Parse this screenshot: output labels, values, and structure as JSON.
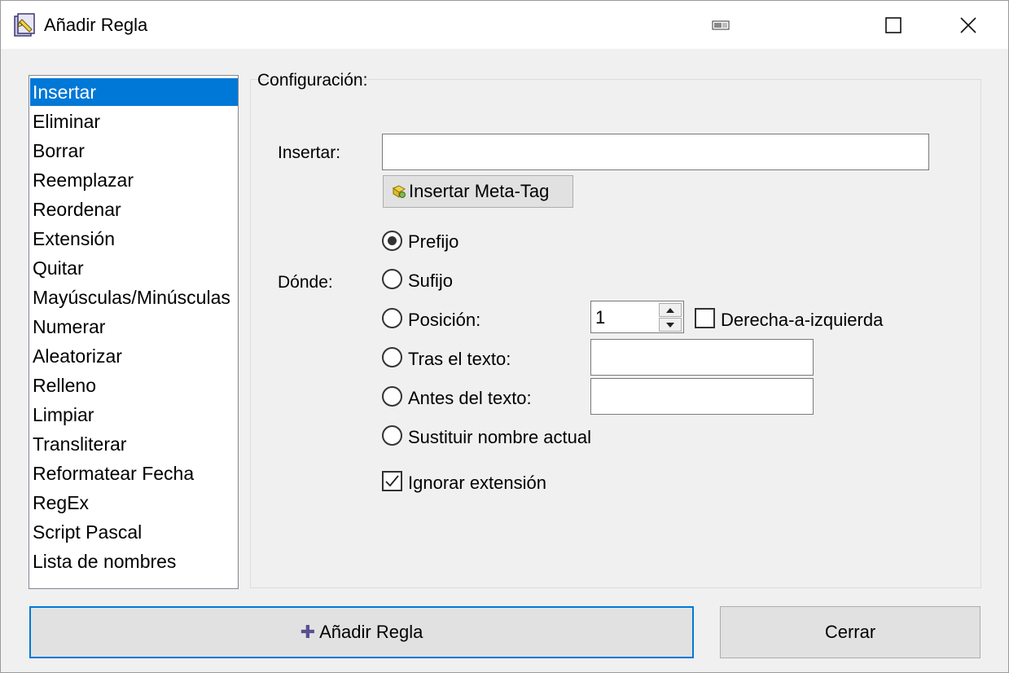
{
  "window": {
    "title": "Añadir Regla"
  },
  "rule_list": {
    "selected_index": 0,
    "items": [
      "Insertar",
      "Eliminar",
      "Borrar",
      "Reemplazar",
      "Reordenar",
      "Extensión",
      "Quitar",
      "Mayúsculas/Minúsculas",
      "Numerar",
      "Aleatorizar",
      "Relleno",
      "Limpiar",
      "Transliterar",
      "Reformatear Fecha",
      "RegEx",
      "Script Pascal",
      "Lista de nombres"
    ]
  },
  "config": {
    "group_label": "Configuración:",
    "insert_label": "Insertar:",
    "insert_value": "",
    "meta_tag_button": "Insertar Meta-Tag",
    "where_label": "Dónde:",
    "options": {
      "prefix": "Prefijo",
      "suffix": "Sufijo",
      "position": "Posición:",
      "after_text": "Tras el texto:",
      "before_text": "Antes del texto:",
      "replace_name": "Sustituir nombre actual"
    },
    "selected_option": "Prefijo",
    "position_value": "1",
    "right_to_left_label": "Derecha-a-izquierda",
    "right_to_left_checked": false,
    "after_text_value": "",
    "before_text_value": "",
    "ignore_extension_label": "Ignorar extensión",
    "ignore_extension_checked": true
  },
  "footer": {
    "add_rule_button": "Añadir Regla",
    "close_button": "Cerrar"
  },
  "colors": {
    "selection": "#0078d7",
    "window_bg": "#f0f0f0",
    "button_bg": "#e1e1e1"
  }
}
